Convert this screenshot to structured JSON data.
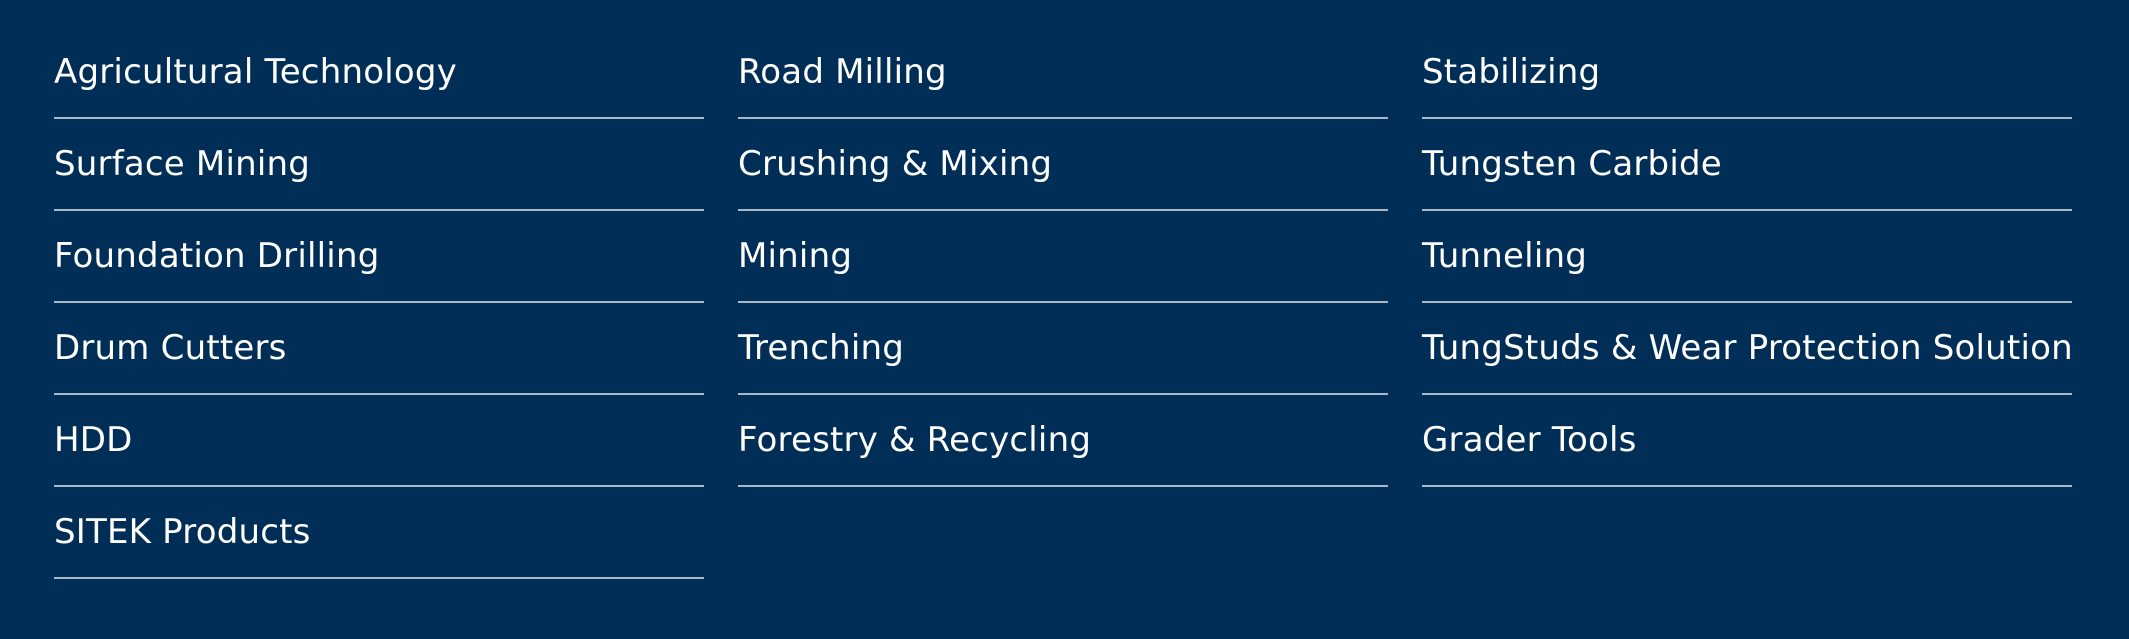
{
  "menu": {
    "colors": {
      "background": "#002e57",
      "text": "#ffffff",
      "divider": "#a9b7c6"
    },
    "columns": [
      {
        "items": [
          {
            "label": "Agricultural Technology"
          },
          {
            "label": "Surface Mining"
          },
          {
            "label": "Foundation Drilling"
          },
          {
            "label": "Drum Cutters"
          },
          {
            "label": "HDD"
          },
          {
            "label": "SITEK Products"
          }
        ]
      },
      {
        "items": [
          {
            "label": "Road Milling"
          },
          {
            "label": "Crushing & Mixing"
          },
          {
            "label": "Mining"
          },
          {
            "label": "Trenching"
          },
          {
            "label": "Forestry & Recycling"
          }
        ]
      },
      {
        "items": [
          {
            "label": "Stabilizing"
          },
          {
            "label": "Tungsten Carbide"
          },
          {
            "label": "Tunneling"
          },
          {
            "label": "TungStuds & Wear Protection Solution"
          },
          {
            "label": "Grader Tools"
          }
        ]
      }
    ]
  }
}
